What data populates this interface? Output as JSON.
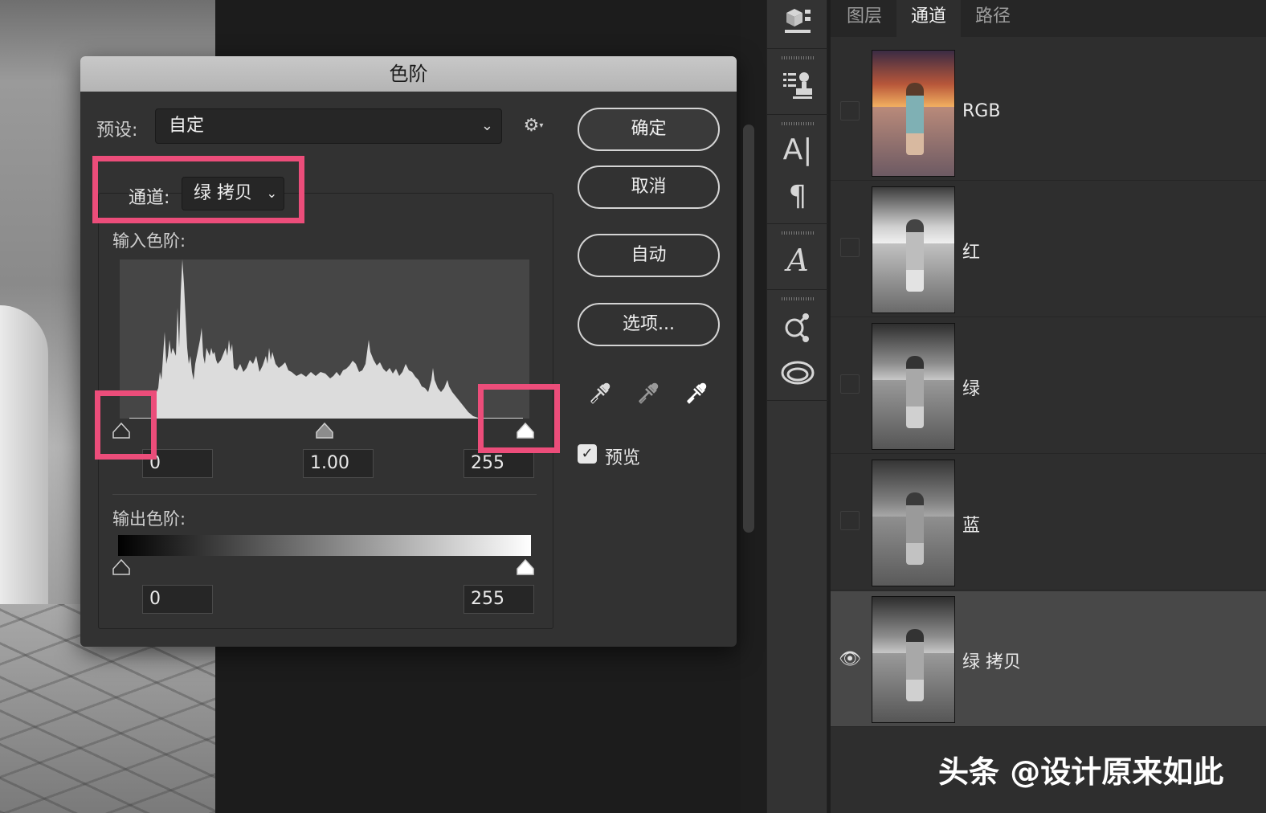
{
  "dialog": {
    "title": "色阶",
    "preset_label": "预设:",
    "preset_value": "自定",
    "channel_label": "通道:",
    "channel_value": "绿 拷贝",
    "input_levels_label": "输入色阶:",
    "input_black": "0",
    "input_gamma": "1.00",
    "input_white": "255",
    "output_levels_label": "输出色阶:",
    "output_black": "0",
    "output_white": "255",
    "buttons": {
      "ok": "确定",
      "cancel": "取消",
      "auto": "自动",
      "options": "选项..."
    },
    "preview_label": "预览",
    "preview_checked": "✓",
    "gear_icon": "⚙",
    "highlight_color": "#ec4d7a"
  },
  "toolbar_strip": {
    "icons": [
      "3d-cube-icon",
      "properties-icon",
      "character-icon",
      "paragraph-icon",
      "glyphs-icon",
      "libraries-icon",
      "creative-cloud-icon"
    ]
  },
  "panel": {
    "tabs": [
      "图层",
      "通道",
      "路径"
    ],
    "active_tab": "通道",
    "channels": [
      {
        "name": "RGB",
        "visible": false,
        "color": true
      },
      {
        "name": "红",
        "visible": false,
        "color": false
      },
      {
        "name": "绿",
        "visible": false,
        "color": false
      },
      {
        "name": "蓝",
        "visible": false,
        "color": false
      },
      {
        "name": "绿 拷贝",
        "visible": true,
        "color": false,
        "selected": true
      }
    ]
  },
  "watermark": "头条 @设计原来如此"
}
